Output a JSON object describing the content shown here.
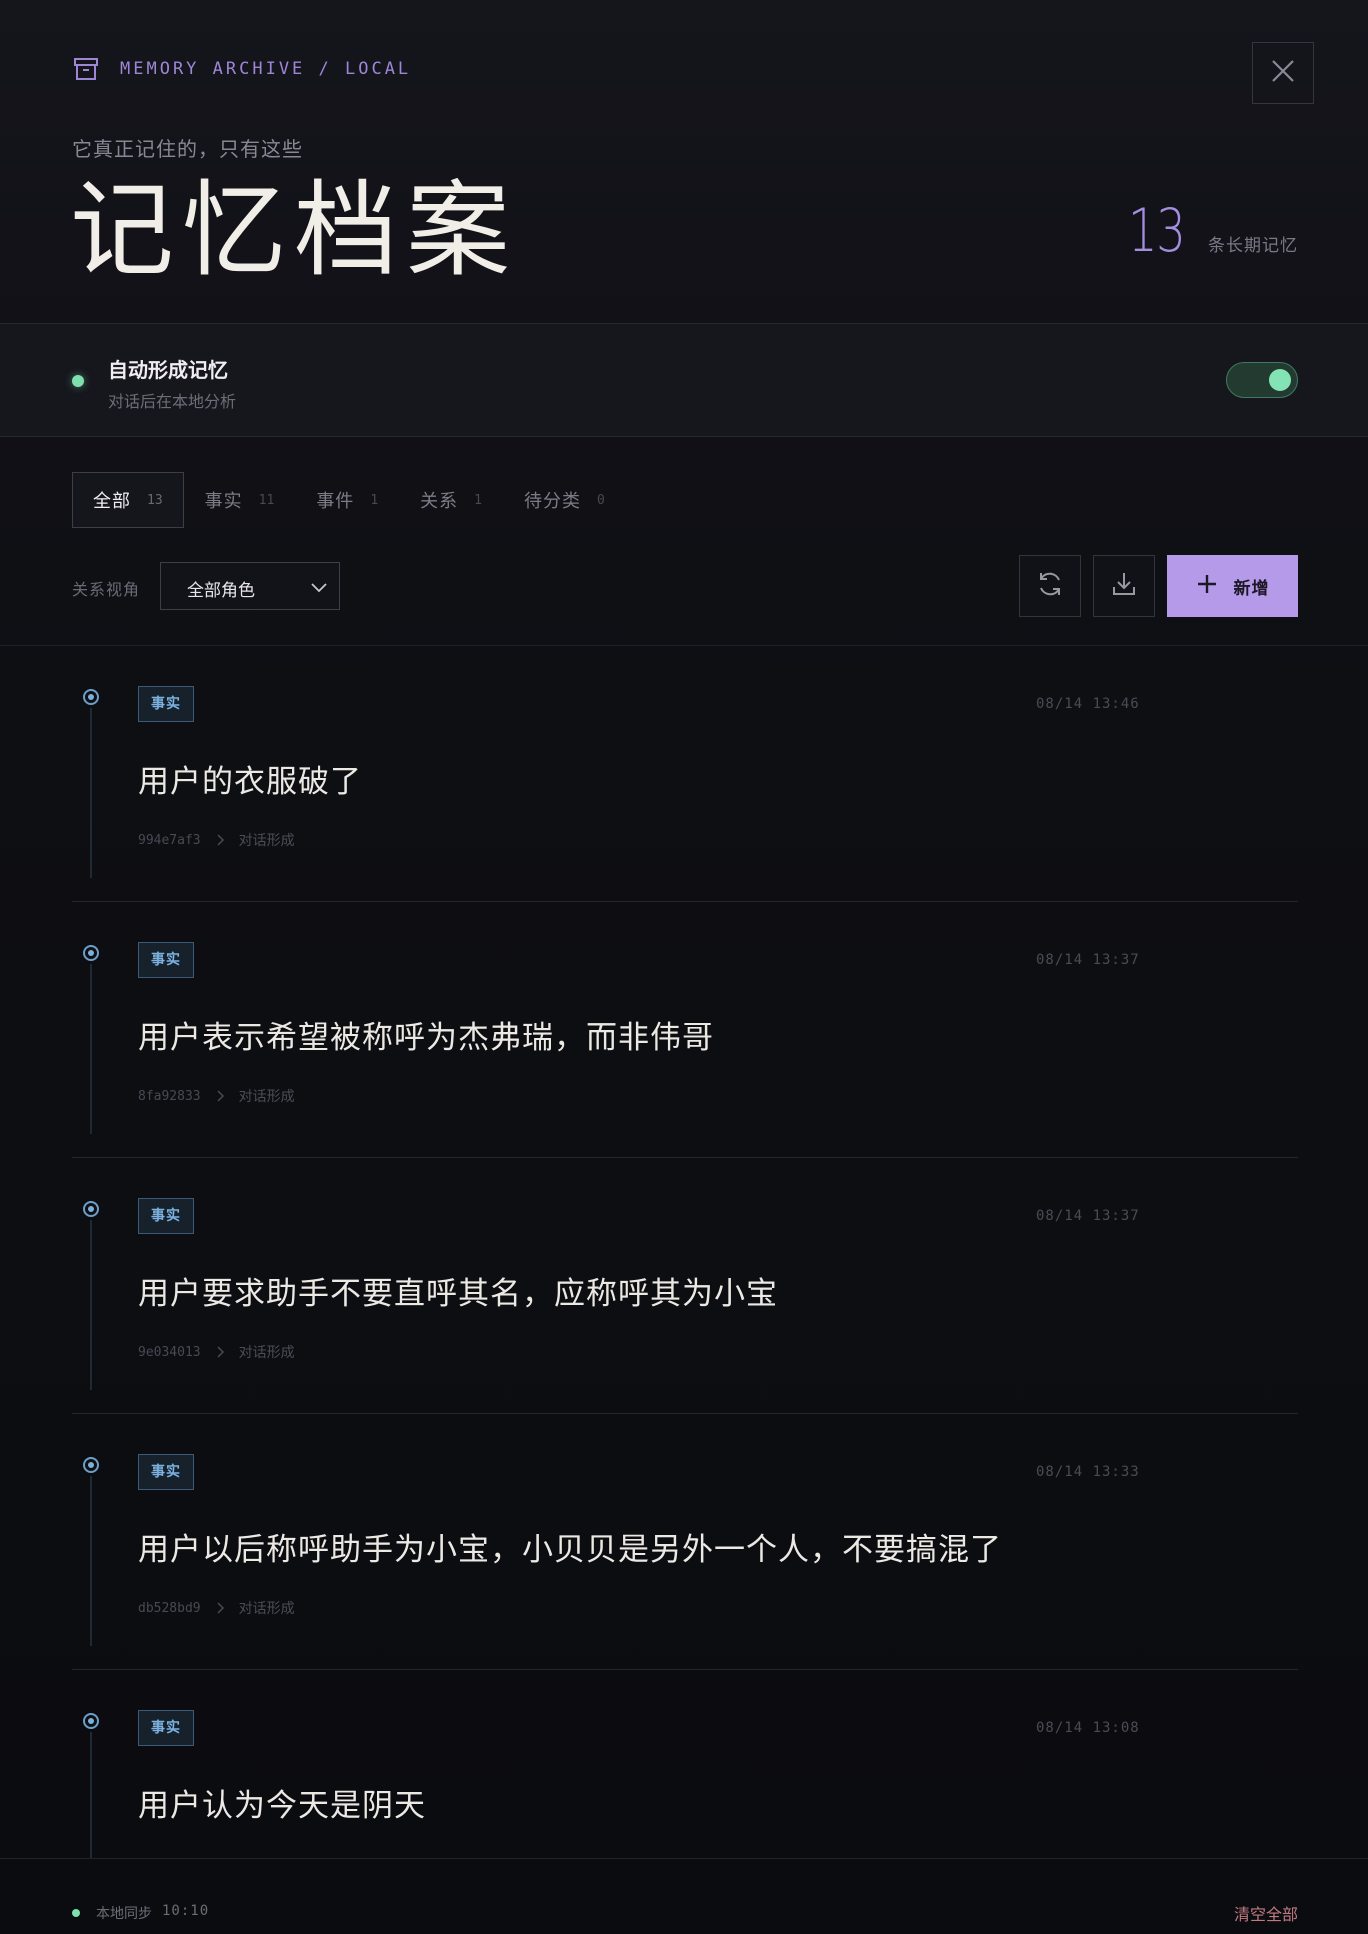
{
  "header": {
    "breadcrumb": "MEMORY ARCHIVE / LOCAL",
    "subtitle": "它真正记住的，只有这些",
    "title": "记忆档案",
    "count": "13",
    "count_label": "条长期记忆"
  },
  "auto_memory": {
    "title": "自动形成记忆",
    "description": "对话后在本地分析",
    "enabled": true
  },
  "tabs": [
    {
      "label": "全部",
      "count": "13",
      "active": true
    },
    {
      "label": "事实",
      "count": "11"
    },
    {
      "label": "事件",
      "count": "1"
    },
    {
      "label": "关系",
      "count": "1"
    },
    {
      "label": "待分类",
      "count": "0"
    }
  ],
  "filter": {
    "label": "关系视角",
    "selected": "全部角色"
  },
  "actions": {
    "add_label": "新增"
  },
  "memories": [
    {
      "type": "事实",
      "time": "08/14 13:46",
      "text": "用户的衣服破了",
      "id": "994e7af3",
      "source": "对话形成"
    },
    {
      "type": "事实",
      "time": "08/14 13:37",
      "text": "用户表示希望被称呼为杰弗瑞，而非伟哥",
      "id": "8fa92833",
      "source": "对话形成"
    },
    {
      "type": "事实",
      "time": "08/14 13:37",
      "text": "用户要求助手不要直呼其名，应称呼其为小宝",
      "id": "9e034013",
      "source": "对话形成"
    },
    {
      "type": "事实",
      "time": "08/14 13:33",
      "text": "用户以后称呼助手为小宝，小贝贝是另外一个人，不要搞混了",
      "id": "db528bd9",
      "source": "对话形成"
    },
    {
      "type": "事实",
      "time": "08/14 13:08",
      "text": "用户认为今天是阴天",
      "id": "",
      "source": ""
    }
  ],
  "footer": {
    "sync_label": "本地同步",
    "sync_time": "10:10",
    "clear_label": "清空全部"
  },
  "colors": {
    "accent": "#b49ae8",
    "online": "#7ee0ad",
    "fact_badge": "#7db2e0",
    "danger": "#c07a82"
  }
}
